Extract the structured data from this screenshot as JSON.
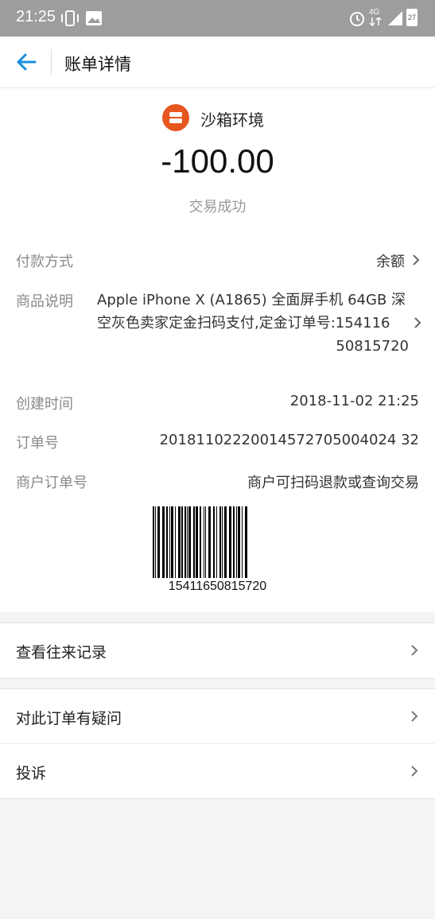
{
  "status_bar": {
    "time": "21:25",
    "network": "4G",
    "battery": "27",
    "icons": [
      "vibrate-icon",
      "image-icon",
      "alarm-icon",
      "network-4g-icon",
      "signal-icon",
      "battery-icon"
    ]
  },
  "nav": {
    "title": "账单详情",
    "back_icon": "back-arrow-icon"
  },
  "merchant": {
    "name": "沙箱环境",
    "amount": "-100.00",
    "status": "交易成功"
  },
  "details": {
    "payment_method_label": "付款方式",
    "payment_method_value": "余额",
    "description_label": "商品说明",
    "description_lines": [
      "Apple iPhone X (A1865) 全面屏手机 64GB 深",
      "空灰色卖家定金扫码支付,定金订单号:154116",
      "50815720"
    ],
    "created_label": "创建时间",
    "created_value": "2018-11-02 21:25",
    "order_no_label": "订单号",
    "order_no_value": "20181102220014572705004024 32",
    "merchant_order_label": "商户订单号",
    "merchant_order_value": "商户可扫码退款或查询交易",
    "barcode_number": "15411650815720"
  },
  "actions": {
    "history": "查看往来记录",
    "question": "对此订单有疑问",
    "complaint": "投诉"
  },
  "colors": {
    "accent": "#1a8fe0",
    "merchant_logo": "#e8561f",
    "status_bar": "#9d9d9d"
  }
}
